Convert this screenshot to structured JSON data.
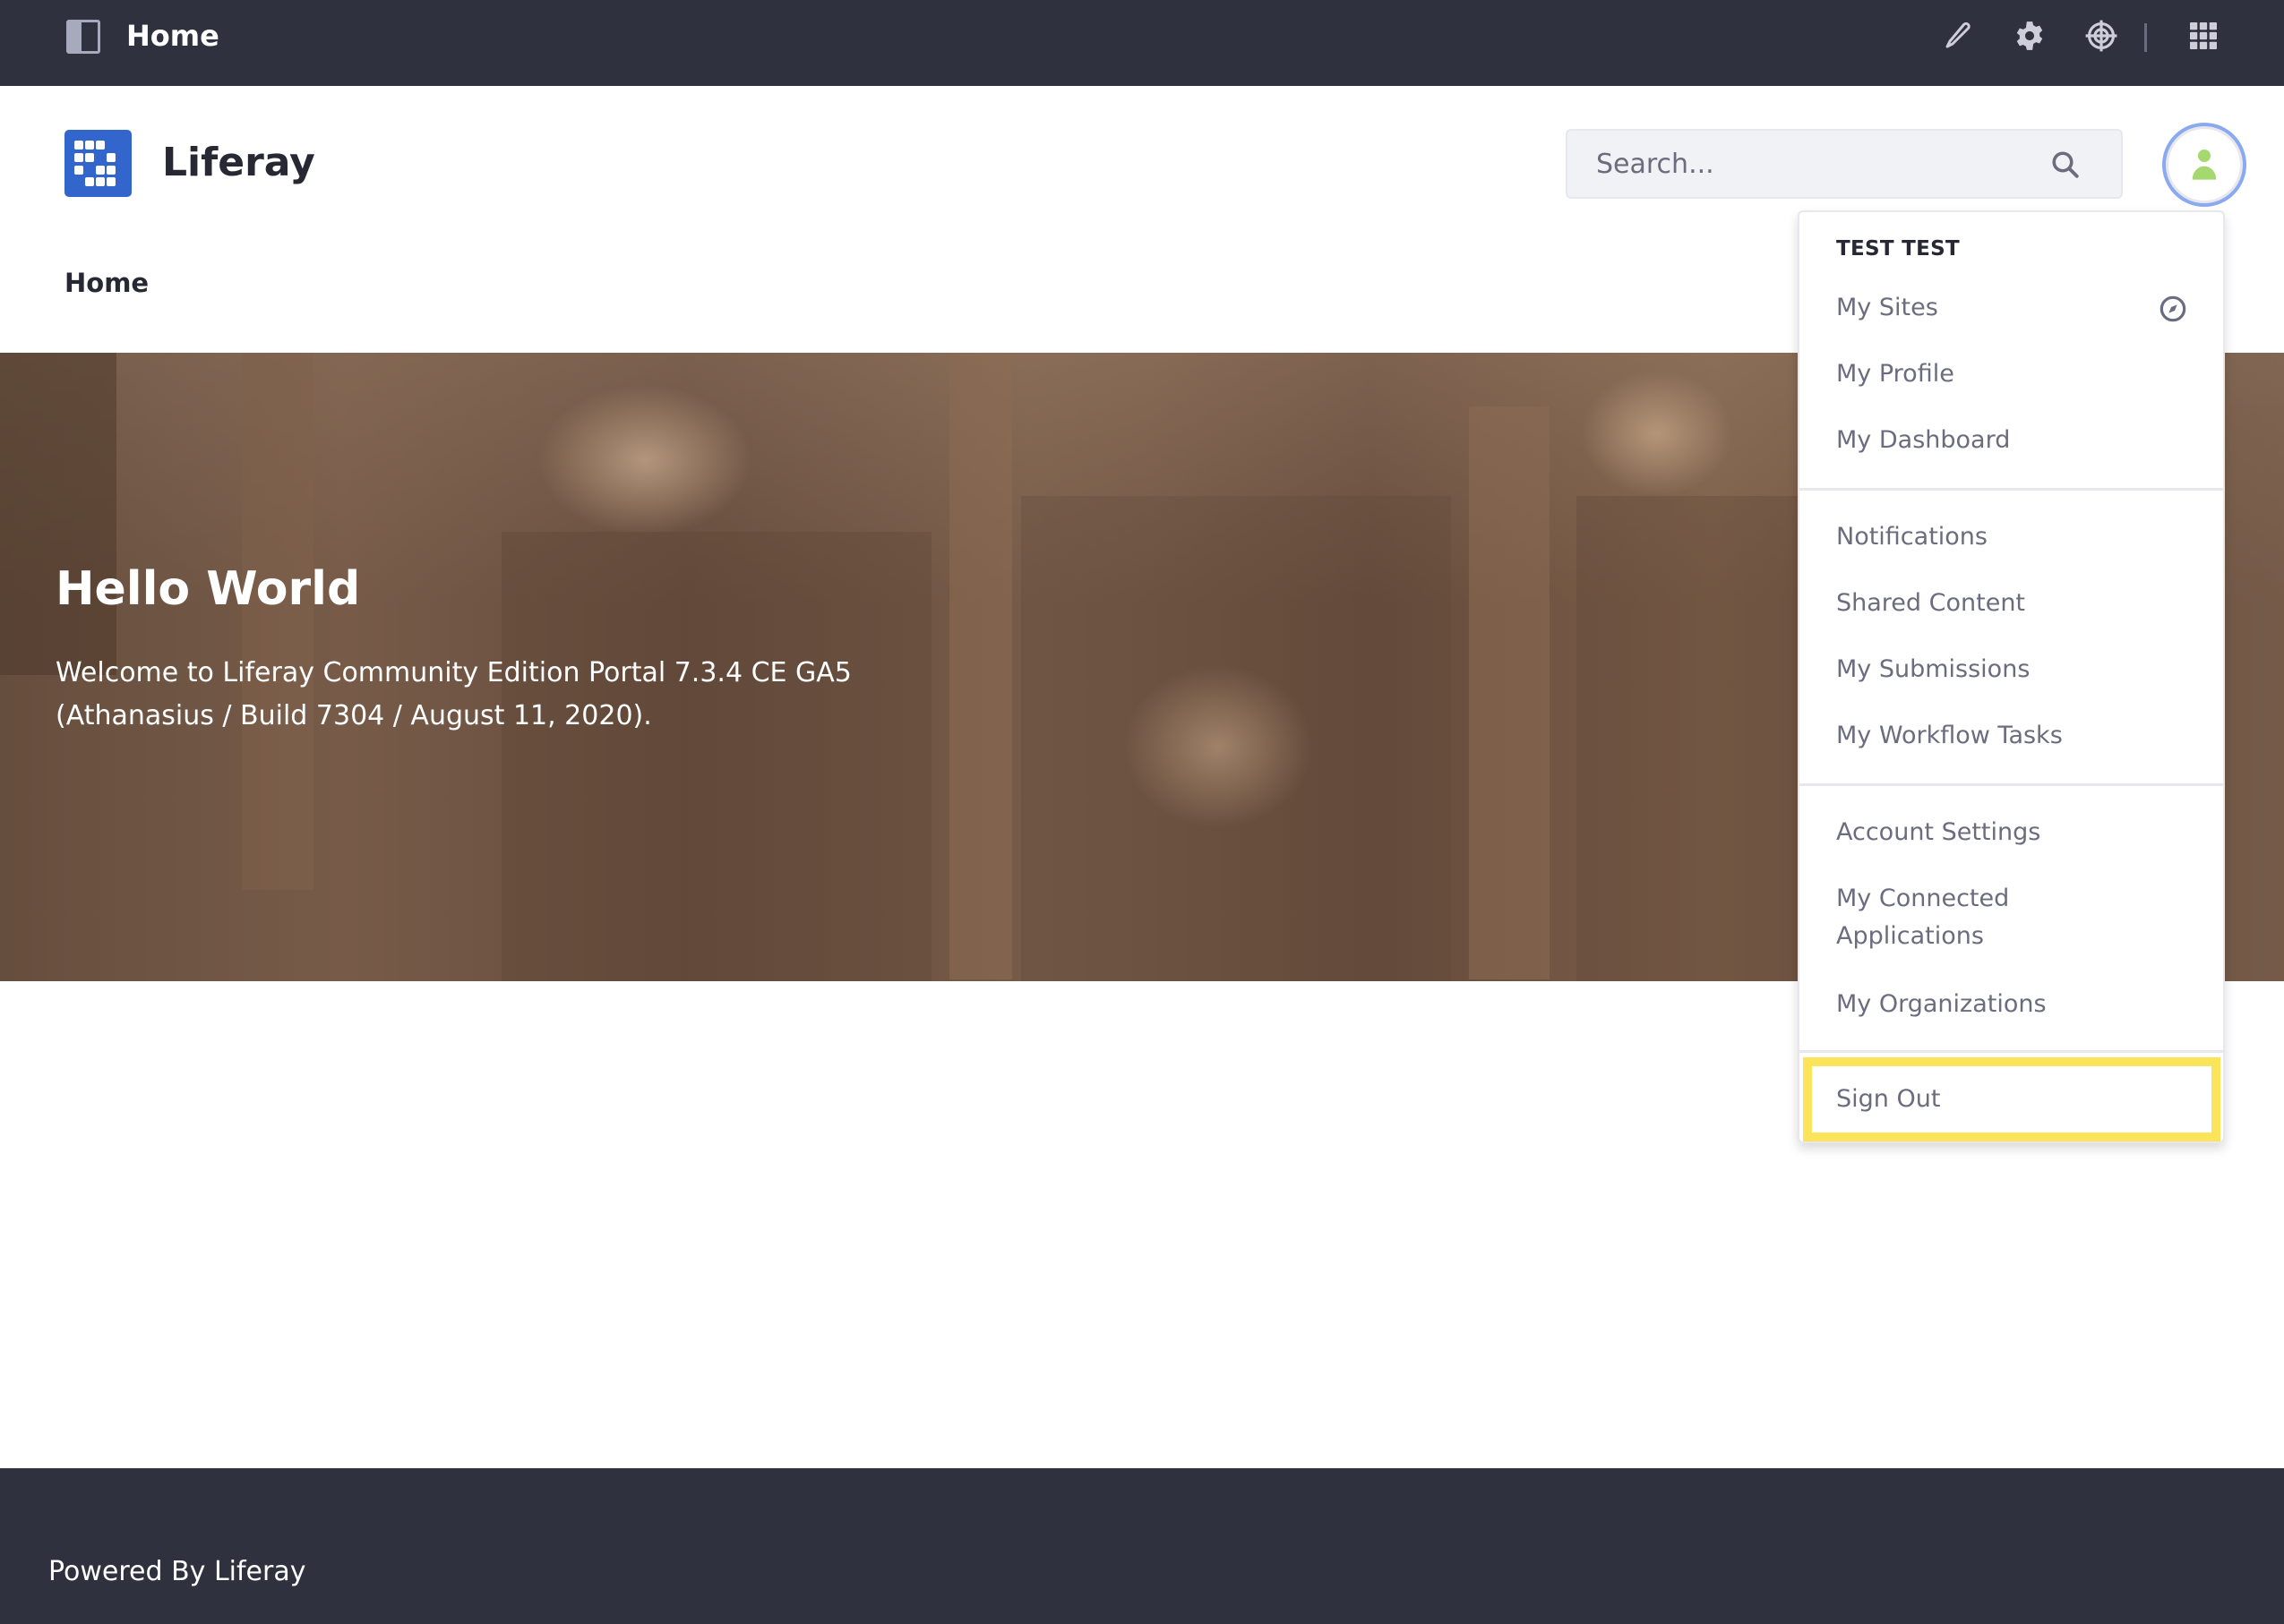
{
  "control_menu": {
    "title": "Home",
    "icons": [
      "panel-toggle-icon",
      "pencil-icon",
      "gear-icon",
      "simulation-target-icon",
      "apps-grid-icon"
    ]
  },
  "header": {
    "site_name": "Liferay",
    "search": {
      "placeholder": "Search...",
      "value": ""
    }
  },
  "breadcrumb": {
    "current": "Home"
  },
  "hero": {
    "title": "Hello World",
    "body": "Welcome to Liferay Community Edition Portal 7.3.4 CE GA5 (Athanasius / Build 7304 / August 11, 2020)."
  },
  "user_menu": {
    "user_name": "TEST TEST",
    "groups": [
      [
        {
          "label": "My Sites",
          "icon": "compass-icon"
        },
        {
          "label": "My Profile"
        },
        {
          "label": "My Dashboard"
        }
      ],
      [
        {
          "label": "Notifications"
        },
        {
          "label": "Shared Content"
        },
        {
          "label": "My Submissions"
        },
        {
          "label": "My Workflow Tasks"
        }
      ],
      [
        {
          "label": "Account Settings"
        },
        {
          "label": "My Connected Applications"
        },
        {
          "label": "My Organizations"
        }
      ],
      [
        {
          "label": "Sign Out",
          "highlighted": true
        }
      ]
    ],
    "highlight_color": "#fce45a"
  },
  "footer": {
    "text": "Powered By Liferay"
  },
  "colors": {
    "topbar": "#30313f",
    "brand": "#3266cc",
    "avatar_icon": "#a5d86e",
    "avatar_ring": "#89aaf0"
  }
}
